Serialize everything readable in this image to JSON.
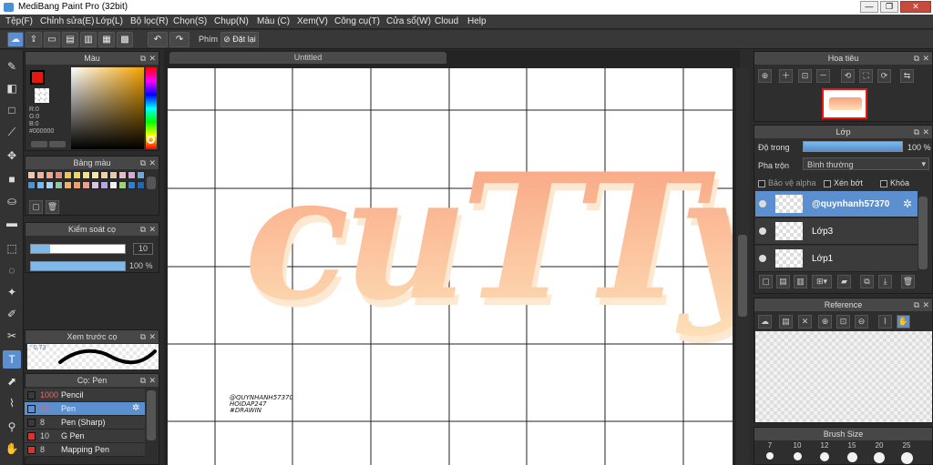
{
  "window": {
    "title": "MediBang Paint Pro (32bit)",
    "min": "—",
    "max": "❐",
    "close": "✕"
  },
  "menu": [
    "Tệp(F)",
    "Chỉnh sửa(E)",
    "Lớp(L)",
    "Bộ lọc(R)",
    "Chọn(S)",
    "Chụp(N)",
    "Màu (C)",
    "Xem(V)",
    "Công cụ(T)",
    "Cửa sổ(W)",
    "Cloud",
    "Help"
  ],
  "toolbar": {
    "pen_label": "Phím",
    "reset_label": "Đặt lại"
  },
  "color_panel": {
    "title": "Màu",
    "r": "R:0",
    "g": "G:0",
    "b": "B:0",
    "hex": "#000000",
    "main_color": "#e8160c"
  },
  "swatch_panel": {
    "title": "Bảng màu",
    "swatches": [
      "#f4c6b0",
      "#f5b09a",
      "#f7a58a",
      "#ef8b74",
      "#f3c34d",
      "#f7d35a",
      "#f5e27a",
      "#f3e7a2",
      "#f2d09a",
      "#eac7a8",
      "#e6b8c8",
      "#d9a6d6",
      "#6aa7e6",
      "#4f8fd6",
      "#79b8ee",
      "#a9d2f2",
      "#8fc7a8",
      "#e9b36b",
      "#f0a06b",
      "#f59b8d",
      "#d9c2e8",
      "#b5a7e0",
      "#f2f2f2",
      "#9ad17a",
      "#2f7ed8",
      "#1f65b8"
    ]
  },
  "brush_control": {
    "title": "Kiểm soát cọ",
    "size": "10",
    "opacity": "100 %"
  },
  "brush_preview": {
    "title": "Xem trước cọ",
    "size_label": "° 0.73"
  },
  "brush_list": {
    "title": "Cọ: Pen",
    "items": [
      {
        "size": "1000",
        "name": "Pencil",
        "color": "#3a3a3a"
      },
      {
        "size": "10",
        "name": "Pen",
        "color": "#5b8fd0"
      },
      {
        "size": "8",
        "name": "Pen (Sharp)",
        "color": "#3a3a3a"
      },
      {
        "size": "10",
        "name": "G Pen",
        "color": "#e82b2b"
      },
      {
        "size": "8",
        "name": "Mapping Pen",
        "color": "#e82b2b"
      }
    ]
  },
  "document": {
    "tab": "Untitled",
    "artwork_text": "cuTTy",
    "watermark": [
      "@QUYNHANH57370",
      "HOIDAP247",
      "#DRAWIN"
    ]
  },
  "navigator": {
    "title": "Hoa tiêu"
  },
  "layers": {
    "title": "Lớp",
    "opacity_label": "Độ trong",
    "opacity_value": "100 %",
    "blend_label": "Pha trộn",
    "blend_value": "Bình thường",
    "protect_alpha": "Bảo vệ alpha",
    "clipping": "Xén bớt",
    "lock": "Khóa",
    "items": [
      {
        "name": "@quynhanh57370",
        "selected": true
      },
      {
        "name": "Lớp3",
        "selected": false
      },
      {
        "name": "Lớp1",
        "selected": false
      }
    ]
  },
  "reference": {
    "title": "Reference"
  },
  "brush_size": {
    "title": "Brush Size",
    "sizes": [
      "7",
      "10",
      "12",
      "15",
      "20",
      "25"
    ]
  }
}
